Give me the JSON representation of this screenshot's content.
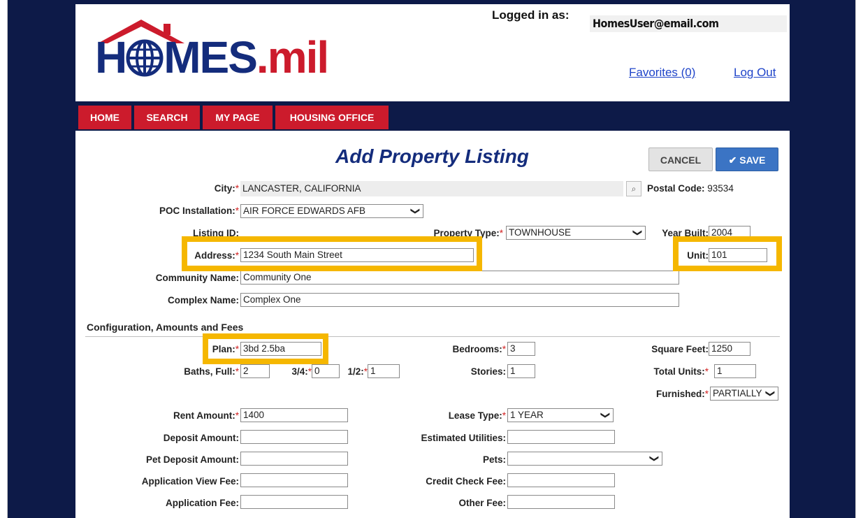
{
  "header": {
    "logo_text_left": "H",
    "logo_text_right": "MES",
    "logo_text_suffix": ".mil",
    "logged_in_label": "Logged in as:",
    "user_email": "HomesUser@email.com",
    "favorites_link": "Favorites (0)",
    "logout_link": "Log Out"
  },
  "nav": {
    "items": [
      {
        "label": "HOME"
      },
      {
        "label": "SEARCH"
      },
      {
        "label": "MY PAGE"
      },
      {
        "label": "HOUSING OFFICE"
      }
    ]
  },
  "page": {
    "title": "Add Property Listing",
    "cancel_label": "CANCEL",
    "save_label": "SAVE",
    "save_icon": "checkmark-icon"
  },
  "form": {
    "city_label": "City:",
    "city_value": "LANCASTER, CALIFORNIA",
    "postal_code_label": "Postal Code:",
    "postal_code_value": "93534",
    "poc_installation_label": "POC Installation:",
    "poc_installation_value": "AIR FORCE EDWARDS AFB",
    "listing_id_label": "Listing ID:",
    "property_type_label": "Property Type:",
    "property_type_value": "TOWNHOUSE",
    "year_built_label": "Year Built:",
    "year_built_value": "2004",
    "address_label": "Address:",
    "address_value": "1234 South Main Street",
    "unit_label": "Unit:",
    "unit_value": "101",
    "community_name_label": "Community Name:",
    "community_name_value": "Community One",
    "complex_name_label": "Complex Name:",
    "complex_name_value": "Complex One"
  },
  "config": {
    "section_title": "Configuration, Amounts and Fees",
    "plan_label": "Plan:",
    "plan_value": "3bd 2.5ba",
    "bedrooms_label": "Bedrooms:",
    "bedrooms_value": "3",
    "square_feet_label": "Square Feet:",
    "square_feet_value": "1250",
    "baths_full_label": "Baths, Full:",
    "baths_full_value": "2",
    "baths_34_label": "3/4:",
    "baths_34_value": "0",
    "baths_half_label": "1/2:",
    "baths_half_value": "1",
    "stories_label": "Stories:",
    "stories_value": "1",
    "total_units_label": "Total Units:",
    "total_units_value": "1",
    "furnished_label": "Furnished:",
    "furnished_value": "PARTIALLY",
    "rent_amount_label": "Rent Amount:",
    "rent_amount_value": "1400",
    "lease_type_label": "Lease Type:",
    "lease_type_value": "1 YEAR",
    "deposit_amount_label": "Deposit Amount:",
    "estimated_utilities_label": "Estimated Utilities:",
    "pet_deposit_amount_label": "Pet Deposit Amount:",
    "pets_label": "Pets:",
    "application_view_fee_label": "Application View Fee:",
    "credit_check_fee_label": "Credit Check Fee:",
    "application_fee_label": "Application Fee:",
    "other_fee_label": "Other Fee:"
  },
  "colors": {
    "navy": "#0d1a48",
    "brand_red": "#cc1b2c",
    "brand_blue": "#142c7c",
    "save_blue": "#3b74c4",
    "highlight_yellow": "#f5b700",
    "required_red": "#d21f1f"
  }
}
